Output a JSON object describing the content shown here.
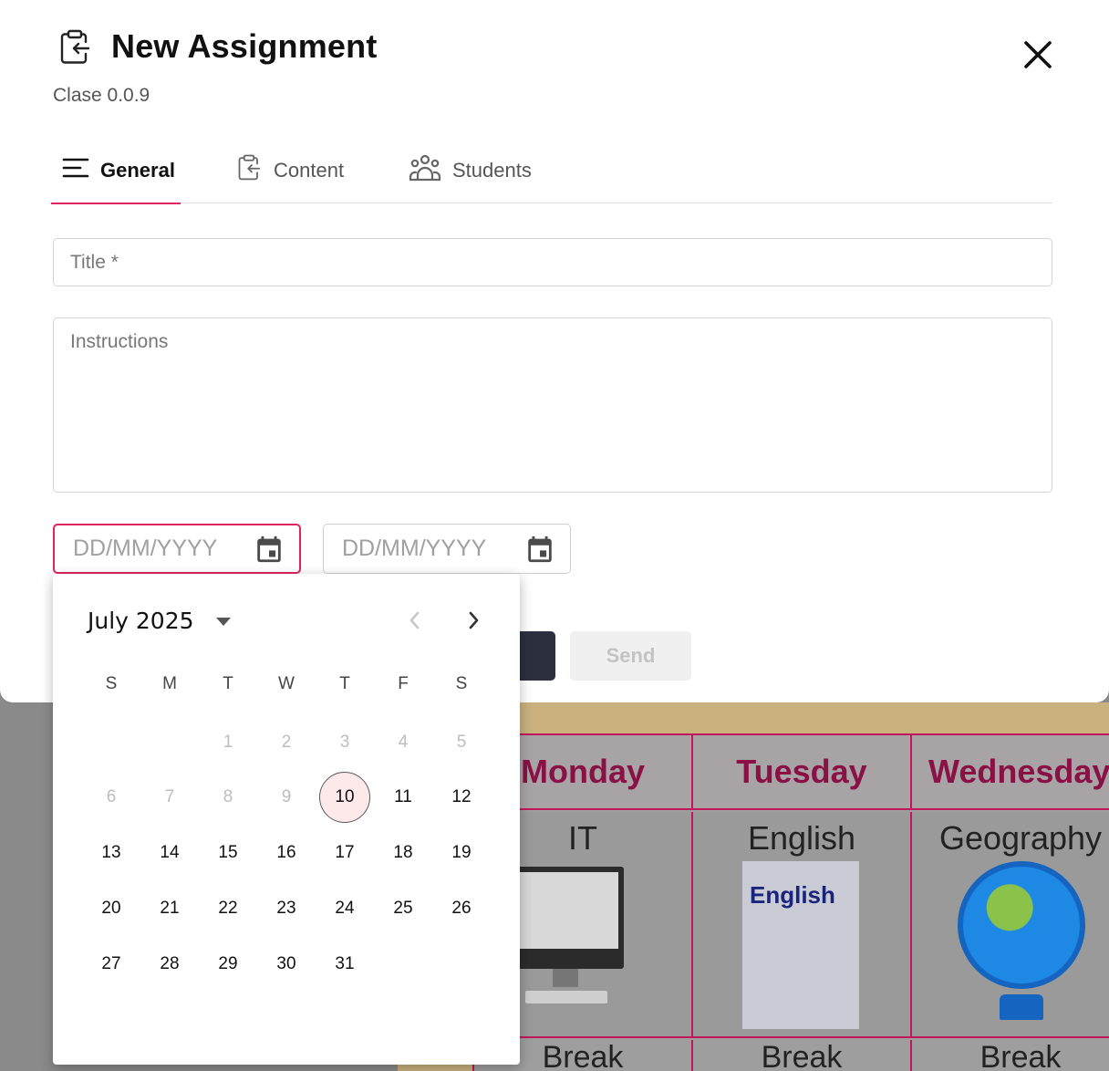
{
  "modal": {
    "title": "New Assignment",
    "subtitle": "Clase 0.0.9",
    "close_icon": "close-icon",
    "header_icon": "clipboard-return-icon"
  },
  "tabs": [
    {
      "label": "General",
      "icon": "menu-lines-icon",
      "active": true
    },
    {
      "label": "Content",
      "icon": "clipboard-return-icon",
      "active": false
    },
    {
      "label": "Students",
      "icon": "users-group-icon",
      "active": false
    }
  ],
  "form": {
    "title_placeholder": "Title *",
    "instructions_placeholder": "Instructions",
    "start_date_placeholder": "DD/MM/YYYY",
    "end_date_placeholder": "DD/MM/YYYY",
    "send_label": "Send"
  },
  "calendar": {
    "month_label": "July 2025",
    "weekdays": [
      "S",
      "M",
      "T",
      "W",
      "T",
      "F",
      "S"
    ],
    "today": 10,
    "first_enabled": 10,
    "days": [
      "1",
      "2",
      "3",
      "4",
      "5",
      "6",
      "7",
      "8",
      "9",
      "10",
      "11",
      "12",
      "13",
      "14",
      "15",
      "16",
      "17",
      "18",
      "19",
      "20",
      "21",
      "22",
      "23",
      "24",
      "25",
      "26",
      "27",
      "28",
      "29",
      "30",
      "31"
    ]
  },
  "background": {
    "days": [
      "Monday",
      "Tuesday",
      "Wednesday"
    ],
    "subjects": [
      "IT",
      "English",
      "Geography"
    ],
    "book_title": "English",
    "breaks": [
      "Break",
      "Break",
      "Break"
    ]
  },
  "colors": {
    "accent": "#e0245e",
    "today_bg": "#fde8ea",
    "dark_button": "#2c2f3e"
  }
}
